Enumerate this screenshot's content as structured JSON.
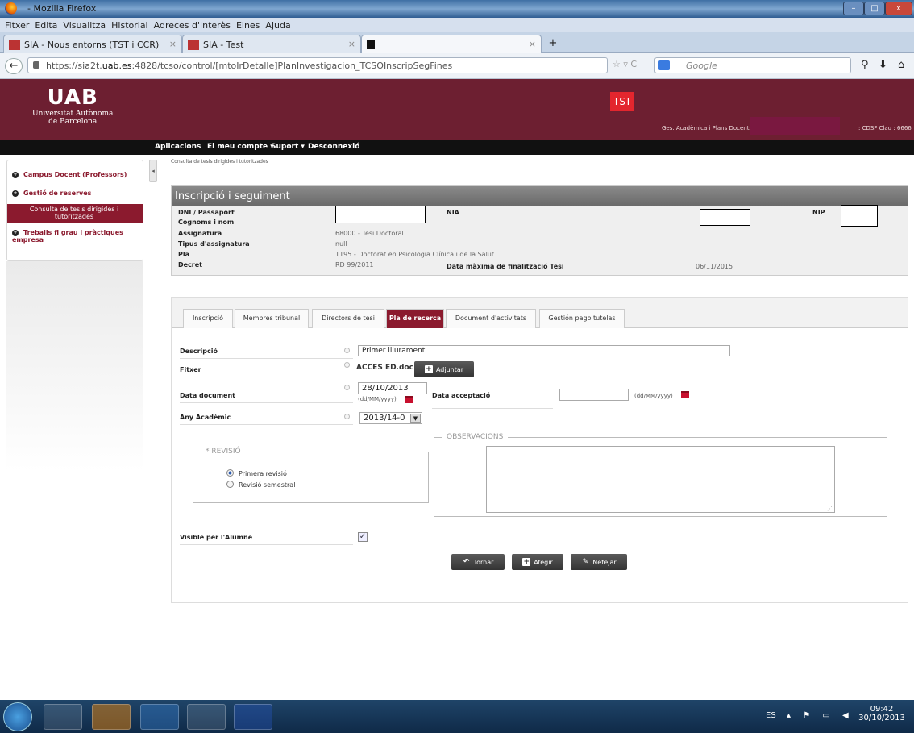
{
  "window": {
    "title": "- Mozilla Firefox",
    "min": "–",
    "max": "□",
    "close": "x"
  },
  "menu": [
    "Fitxer",
    "Edita",
    "Visualitza",
    "Historial",
    "Adreces d'interès",
    "Eines",
    "Ajuda"
  ],
  "tabs": [
    {
      "label": "SIA - Nous entorns (TST i CCR)"
    },
    {
      "label": "SIA - Test"
    },
    {
      "label": ""
    }
  ],
  "newtab": "+",
  "url": {
    "prefix": "https://sia2t.",
    "host": "uab.es",
    "rest": ":4828/tcso/control/[mtoIrDetalle]PlanInvestigacion_TCSOInscripSegFines"
  },
  "search_placeholder": "Google",
  "header": {
    "logo_big": "UAB",
    "logo_line1": "Universitat Autònoma",
    "logo_line2": "de Barcelona",
    "env_badge": "TST",
    "user_role": "Ges. Acadèmica i Plans Docents",
    "user_code": ": CDSF  Clau : 6666"
  },
  "nav": [
    "Aplicacions",
    "El meu compte ▾",
    "Suport ▾",
    "Desconnexió"
  ],
  "sidebar": {
    "items": [
      {
        "label": "Campus Docent (Professors)"
      },
      {
        "label": "Gestió de reserves"
      },
      {
        "label": "Consulta de tesis dirigides i tutoritzades"
      },
      {
        "label": "Treballs fi grau i pràctiques empresa"
      }
    ],
    "collapse": "◂"
  },
  "breadcrumb": "Consulta de tesis dirigides i tutoritzades",
  "info": {
    "title": "Inscripció i seguiment",
    "labels": {
      "dni": "DNI / Passaport",
      "nia": "NIA",
      "nip": "NIP",
      "cognoms": "Cognoms i nom",
      "assignatura": "Assignatura",
      "tipus": "Tipus d'assignatura",
      "pla": "Pla",
      "decret": "Decret",
      "data_max": "Data màxima de finalització Tesi"
    },
    "values": {
      "assignatura": "68000 - Tesi Doctoral",
      "tipus": "null",
      "pla": "1195 - Doctorat en Psicologia Clínica i de la Salut",
      "decret": "RD 99/2011",
      "data_max": "06/11/2015"
    }
  },
  "ptabs": [
    {
      "label": "Inscripció"
    },
    {
      "label": "Membres tribunal"
    },
    {
      "label": "Directors de tesi"
    },
    {
      "label": "Pla de recerca"
    },
    {
      "label": "Document d'activitats"
    },
    {
      "label": "Gestión pago tutelas"
    }
  ],
  "form": {
    "descripcio_label": "Descripció",
    "descripcio_value": "Primer lliurament",
    "fitxer_label": "Fitxer",
    "fitxer_value": "ACCES ED.doc",
    "adjuntar": "Adjuntar",
    "data_doc_label": "Data document",
    "data_doc_value": "28/10/2013",
    "date_format": "(dd/MM/yyyy)",
    "data_accept_label": "Data acceptació",
    "data_accept_value": "",
    "any_label": "Any Acadèmic",
    "any_value": "2013/14-0",
    "revisio_legend": "* REVISIÓ",
    "radio1": "Primera revisió",
    "radio2": "Revisió semestral",
    "observacions_legend": "OBSERVACIONS",
    "visible_label": "Visible per l'Alumne",
    "check_mark": "✓"
  },
  "buttons": {
    "tornar": "Tornar",
    "afegir": "Afegir",
    "netejar": "Netejar"
  },
  "taskbar": {
    "lang": "ES",
    "time": "09:42",
    "date": "30/10/2013"
  }
}
